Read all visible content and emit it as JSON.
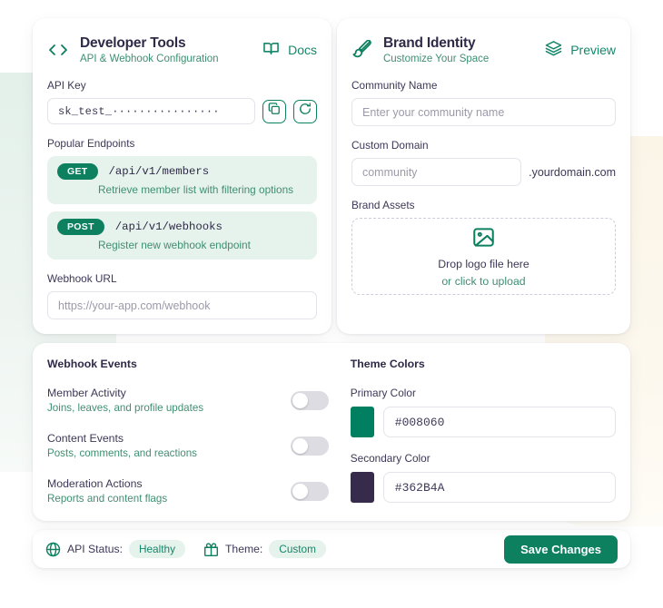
{
  "dev_panel": {
    "icon": "code-brackets-icon",
    "title": "Developer Tools",
    "subtitle": "API & Webhook Configuration",
    "action_icon": "book-icon",
    "action_label": "Docs",
    "api_key_label": "API Key",
    "api_key_value": "sk_test_················",
    "copy_icon": "copy-icon",
    "regenerate_icon": "refresh-icon",
    "endpoints_label": "Popular Endpoints",
    "endpoints": [
      {
        "method": "GET",
        "path": "/api/v1/members",
        "description": "Retrieve member list with filtering options"
      },
      {
        "method": "POST",
        "path": "/api/v1/webhooks",
        "description": "Register new webhook endpoint"
      }
    ],
    "webhook_url_label": "Webhook URL",
    "webhook_url_placeholder": "https://your-app.com/webhook",
    "webhook_url_value": ""
  },
  "brand_panel": {
    "icon": "paintbrush-icon",
    "title": "Brand Identity",
    "subtitle": "Customize Your Space",
    "action_icon": "layers-icon",
    "action_label": "Preview",
    "community_name_label": "Community Name",
    "community_name_placeholder": "Enter your community name",
    "community_name_value": "",
    "custom_domain_label": "Custom Domain",
    "custom_domain_placeholder": "community",
    "custom_domain_value": "",
    "domain_suffix": ".yourdomain.com",
    "brand_assets_label": "Brand Assets",
    "dropzone_icon": "image-icon",
    "dropzone_line1": "Drop logo file here",
    "dropzone_line2": "or click to upload"
  },
  "webhook_events": {
    "title": "Webhook Events",
    "items": [
      {
        "name": "Member Activity",
        "description": "Joins, leaves, and profile updates",
        "enabled": false
      },
      {
        "name": "Content Events",
        "description": "Posts, comments, and reactions",
        "enabled": false
      },
      {
        "name": "Moderation Actions",
        "description": "Reports and content flags",
        "enabled": false
      }
    ]
  },
  "theme_colors": {
    "title": "Theme Colors",
    "primary_label": "Primary Color",
    "primary_value": "#008060",
    "secondary_label": "Secondary Color",
    "secondary_value": "#362B4A"
  },
  "status_bar": {
    "api_status_icon": "globe-icon",
    "api_status_label": "API Status:",
    "api_status_value": "Healthy",
    "theme_icon": "gift-icon",
    "theme_label": "Theme:",
    "theme_value": "Custom",
    "save_label": "Save Changes"
  }
}
